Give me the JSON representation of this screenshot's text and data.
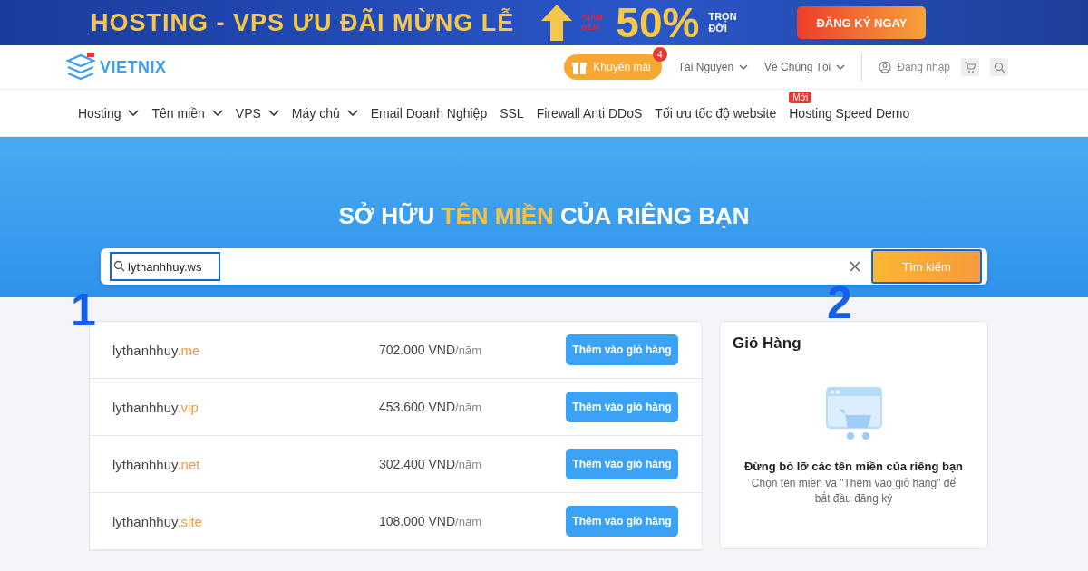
{
  "promo_banner": {
    "headline": "HOSTING - VPS ƯU ĐÃI MỪNG LỄ",
    "discount_prefix": "GIẢM ĐẾN",
    "discount": "50%",
    "discount_suffix": "TRỌN ĐỜI",
    "cta": "ĐĂNG KÝ NGAY"
  },
  "header": {
    "logo": "VIETNIX",
    "promo": {
      "label": "Khuyến mãi",
      "badge": "4"
    },
    "menus": [
      {
        "label": "Tài Nguyên",
        "has_dropdown": true
      },
      {
        "label": "Về Chúng Tôi",
        "has_dropdown": true
      }
    ],
    "login": "Đăng nhập"
  },
  "nav": [
    {
      "label": "Hosting",
      "has_dropdown": true
    },
    {
      "label": "Tên miền",
      "has_dropdown": true
    },
    {
      "label": "VPS",
      "has_dropdown": true
    },
    {
      "label": "Máy chủ",
      "has_dropdown": true
    },
    {
      "label": "Email Doanh Nghiệp",
      "has_dropdown": false
    },
    {
      "label": "SSL",
      "has_dropdown": false
    },
    {
      "label": "Firewall Anti DDoS",
      "has_dropdown": false
    },
    {
      "label": "Tối ưu tốc độ website",
      "has_dropdown": false
    },
    {
      "label": "Hosting Speed Demo",
      "has_dropdown": false,
      "badge": "Mới"
    }
  ],
  "hero": {
    "title_before": "SỞ HỮU",
    "title_highlight": "TÊN MIỀN",
    "title_after": "CỦA RIÊNG BẠN"
  },
  "search": {
    "value": "lythanhhuy.ws",
    "highlighted": true,
    "button": "Tìm kiếm",
    "button_highlighted": true
  },
  "annotations": [
    "1",
    "2"
  ],
  "results": [
    {
      "name": "lythanhhuy",
      "tld": ".me",
      "price": "702.000 VND",
      "unit": "/năm",
      "button": "Thêm vào giỏ hàng"
    },
    {
      "name": "lythanhhuy",
      "tld": ".vip",
      "price": "453.600 VND",
      "unit": "/năm",
      "button": "Thêm vào giỏ hàng"
    },
    {
      "name": "lythanhhuy",
      "tld": ".net",
      "price": "302.400 VND",
      "unit": "/năm",
      "button": "Thêm vào giỏ hàng"
    },
    {
      "name": "lythanhhuy",
      "tld": ".site",
      "price": "108.000 VND",
      "unit": "/năm",
      "button": "Thêm vào giỏ hàng"
    }
  ],
  "cart": {
    "title": "Giỏ Hàng",
    "empty_title": "Đừng bỏ lỡ các tên miền của riêng bạn",
    "empty_text": "Chọn tên miền và \"Thêm vào giỏ hàng\" để bắt đầu đăng ký"
  }
}
